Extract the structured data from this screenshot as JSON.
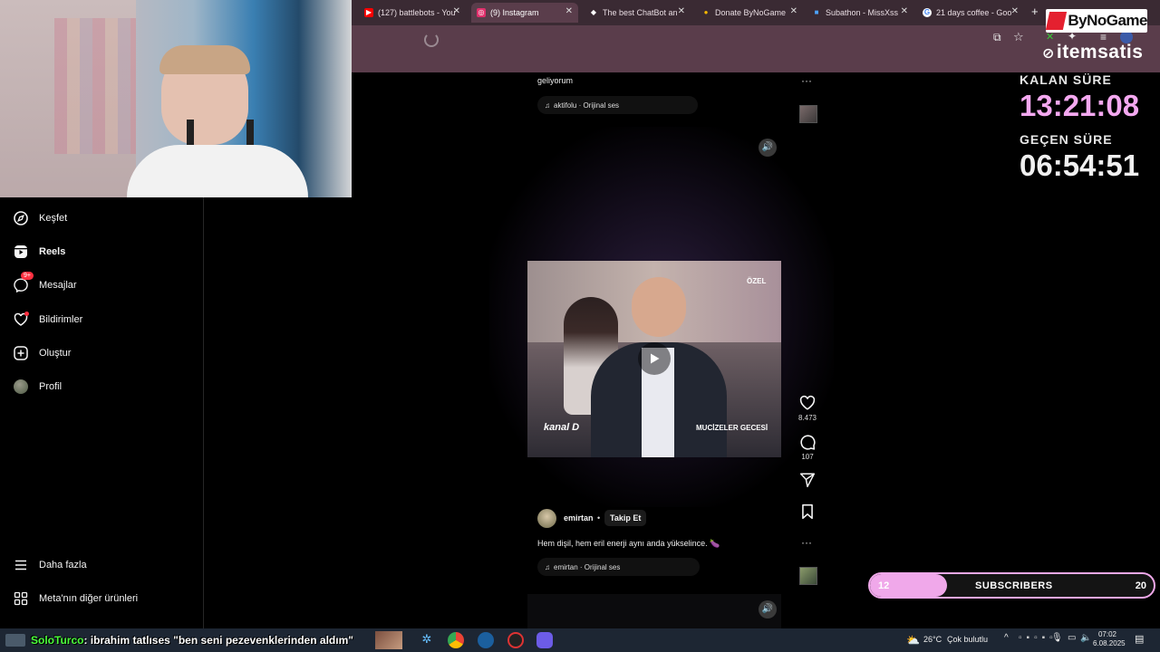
{
  "browser": {
    "tabs": [
      {
        "label": "(127) battlebots - You",
        "icon": "youtube-icon",
        "color": "#ff0000"
      },
      {
        "label": "(9) Instagram",
        "icon": "instagram-icon",
        "color": "#e1306c"
      },
      {
        "label": "The best ChatBot an",
        "icon": "chatbot-icon",
        "color": "#ffffff"
      },
      {
        "label": "Donate ByNoGame",
        "icon": "donate-icon",
        "color": "#f5b800"
      },
      {
        "label": "Subathon - MissXss",
        "icon": "subathon-icon",
        "color": "#4da3ff"
      },
      {
        "label": "21 days coffee - Goo",
        "icon": "google-icon",
        "color": "#4285f4"
      }
    ],
    "active_tab": 1
  },
  "sidebar": {
    "items": [
      {
        "label": "Keşfet",
        "icon": "compass-icon"
      },
      {
        "label": "Reels",
        "icon": "reels-icon"
      },
      {
        "label": "Mesajlar",
        "icon": "messenger-icon",
        "badge": "9+"
      },
      {
        "label": "Bildirimler",
        "icon": "heart-icon"
      },
      {
        "label": "Oluştur",
        "icon": "plus-square-icon"
      },
      {
        "label": "Profil",
        "icon": "avatar"
      }
    ],
    "bottom": [
      {
        "label": "Daha fazla",
        "icon": "menu-icon"
      },
      {
        "label": "Meta'nın diğer ürünleri",
        "icon": "grid-icon"
      }
    ]
  },
  "feed": {
    "prev_caption": "geliyorum",
    "prev_audio": "aktifolu · Orijinal ses",
    "reel_badge": "ÖZEL",
    "reel_channel": "kanal D",
    "reel_show": "MUCİZELER GECESİ",
    "likes": "8.473",
    "comments": "107",
    "author": "emirtan",
    "dot": "•",
    "follow": "Takip Et",
    "caption": "Hem dişil, hem eril enerji aynı anda yükselince. 🍆",
    "audio": "emirtan · Orijinal ses"
  },
  "overlay": {
    "brand1": "ByNoGame",
    "brand2": "itemsatis",
    "remaining_label": "KALAN SÜRE",
    "remaining_value": "13:21:08",
    "elapsed_label": "GEÇEN SÜRE",
    "elapsed_value": "06:54:51",
    "sub_start": "12",
    "sub_label": "SUBSCRIBERS",
    "sub_goal": "20",
    "sub_progress": 0.27,
    "colors": {
      "remaining": "#f4a8f0",
      "elapsed": "#f0f0f0",
      "sub_bar": "#f0a8ea"
    }
  },
  "taskbar": {
    "chat_user": "SoloTurco",
    "chat_message": ": ibrahim tatlıses \"ben seni pezevenklerinden aldım\"",
    "weather_temp": "26°C",
    "weather_text": "Çok bulutlu",
    "time": "07:02",
    "date": "6.08.2025"
  }
}
